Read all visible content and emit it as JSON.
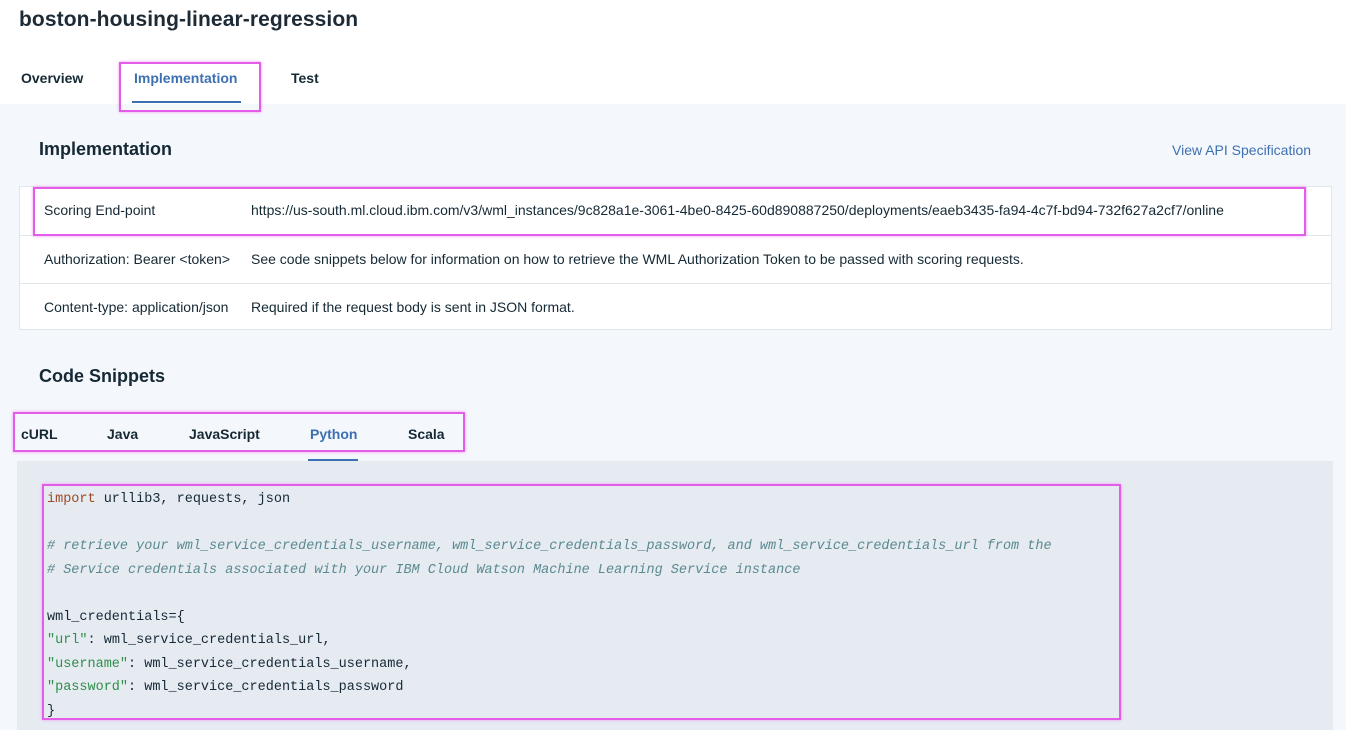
{
  "page": {
    "title": "boston-housing-linear-regression"
  },
  "tabs": [
    {
      "label": "Overview",
      "active": false
    },
    {
      "label": "Implementation",
      "active": true
    },
    {
      "label": "Test",
      "active": false
    }
  ],
  "implementation": {
    "heading": "Implementation",
    "api_link": "View API Specification",
    "rows": [
      {
        "key": "Scoring End-point",
        "value": "https://us-south.ml.cloud.ibm.com/v3/wml_instances/9c828a1e-3061-4be0-8425-60d890887250/deployments/eaeb3435-fa94-4c7f-bd94-732f627a2cf7/online"
      },
      {
        "key": "Authorization: Bearer <token>",
        "value": "See code snippets below for information on how to retrieve the WML Authorization Token to be passed with scoring requests."
      },
      {
        "key": "Content-type: application/json",
        "value": "Required if the request body is sent in JSON format."
      }
    ]
  },
  "snippets": {
    "heading": "Code Snippets",
    "tabs": [
      {
        "label": "cURL",
        "active": false
      },
      {
        "label": "Java",
        "active": false
      },
      {
        "label": "JavaScript",
        "active": false
      },
      {
        "label": "Python",
        "active": true
      },
      {
        "label": "Scala",
        "active": false
      }
    ],
    "code": {
      "l1_kw": "import",
      "l1_rest": " urllib3, requests, json",
      "l3": "# retrieve your wml_service_credentials_username, wml_service_credentials_password, and wml_service_credentials_url from the",
      "l4": "# Service credentials associated with your IBM Cloud Watson Machine Learning Service instance",
      "l6": "wml_credentials={",
      "l7_key": "\"url\"",
      "l7_rest": ": wml_service_credentials_url,",
      "l8_key": "\"username\"",
      "l8_rest": ": wml_service_credentials_username,",
      "l9_key": "\"password\"",
      "l9_rest": ": wml_service_credentials_password",
      "l10": "}"
    }
  },
  "colors": {
    "accent": "#3d70b2",
    "highlight": "#e35de8",
    "code_bg": "#e6ebf2"
  }
}
